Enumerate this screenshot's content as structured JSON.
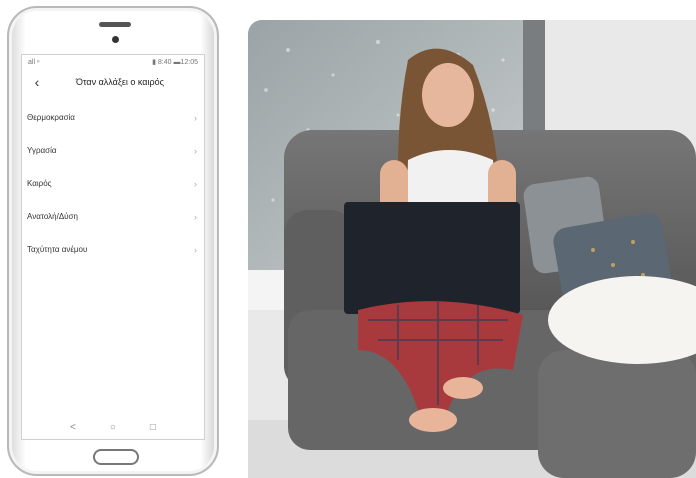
{
  "phone": {
    "status_left": "all ⁿ",
    "status_right": "▮ 8:40 ▬12:05",
    "screen_title": "Όταν αλλάξει ο καιρός",
    "back_icon": "chevron-left-icon",
    "menu_items": [
      {
        "label": "Θερμοκρασία"
      },
      {
        "label": "Υγρασία"
      },
      {
        "label": "Καιρός"
      },
      {
        "label": "Ανατολή/Δύση"
      },
      {
        "label": "Ταχύτητα ανέμου"
      }
    ],
    "chevron": "›",
    "nav": {
      "back": "<",
      "home": "○",
      "recents": "□"
    }
  },
  "photo": {
    "description_colors": {
      "sofa": "#6b6b6b",
      "wall": "#ececec",
      "laptop": "#1f232b",
      "pajamas": "#a83a3e"
    }
  }
}
